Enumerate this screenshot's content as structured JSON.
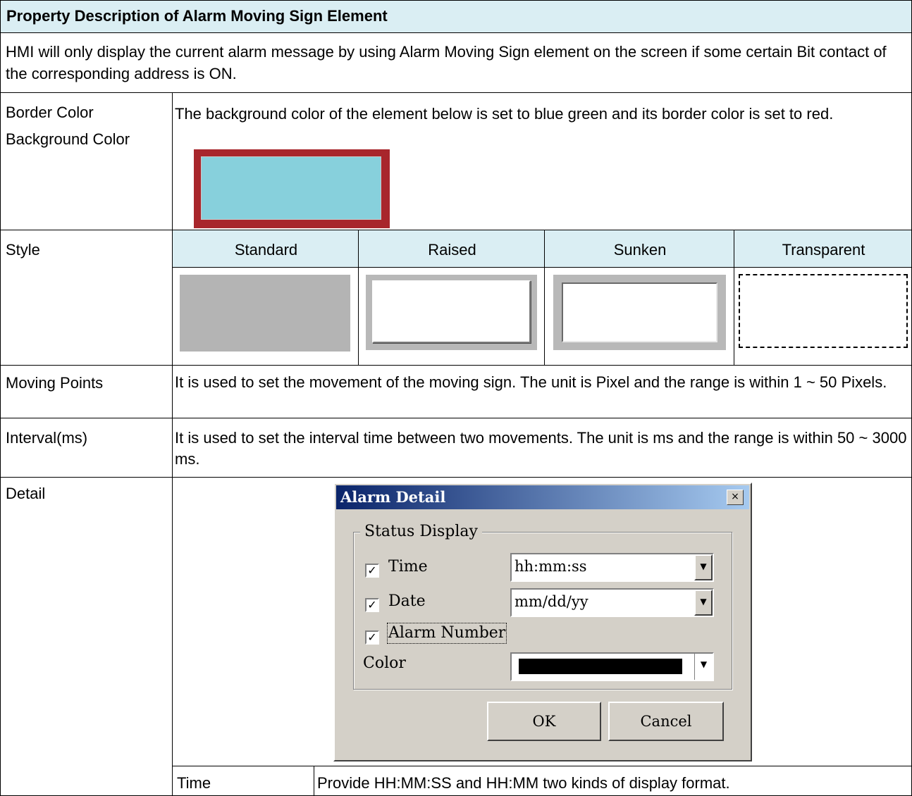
{
  "title": "Property Description of Alarm Moving Sign Element",
  "intro": "HMI will only display the current alarm message by using Alarm Moving Sign element on the screen if some certain Bit contact of the corresponding address is ON.",
  "rows": {
    "border": {
      "label1": "Border Color",
      "label2": "Background Color",
      "desc": "The background color of the element below is set to blue green and its border color is set to red.",
      "sample_fill": "#87d0dc",
      "sample_border": "#a8262c"
    },
    "style": {
      "label": "Style",
      "options": [
        "Standard",
        "Raised",
        "Sunken",
        "Transparent"
      ]
    },
    "moving_points": {
      "label": "Moving Points",
      "desc": "It is used to set the movement of the moving sign. The unit is Pixel and the range is within 1 ~ 50 Pixels."
    },
    "interval": {
      "label": "Interval(ms)",
      "desc": "It is used to set the interval time between two movements. The unit is ms and the range is within 50 ~ 3000 ms."
    },
    "detail": {
      "label": "Detail",
      "dialog": {
        "title": "Alarm Detail",
        "close_icon": "×",
        "group": "Status Display",
        "time_label": "Time",
        "time_format": "hh:mm:ss",
        "date_label": "Date",
        "date_format": "mm/dd/yy",
        "alarm_number_label": "Alarm Number",
        "color_label": "Color",
        "color_value": "#000000",
        "ok": "OK",
        "cancel": "Cancel"
      },
      "sub": {
        "label": "Time",
        "desc": "Provide HH:MM:SS and HH:MM two kinds of display format."
      }
    }
  }
}
